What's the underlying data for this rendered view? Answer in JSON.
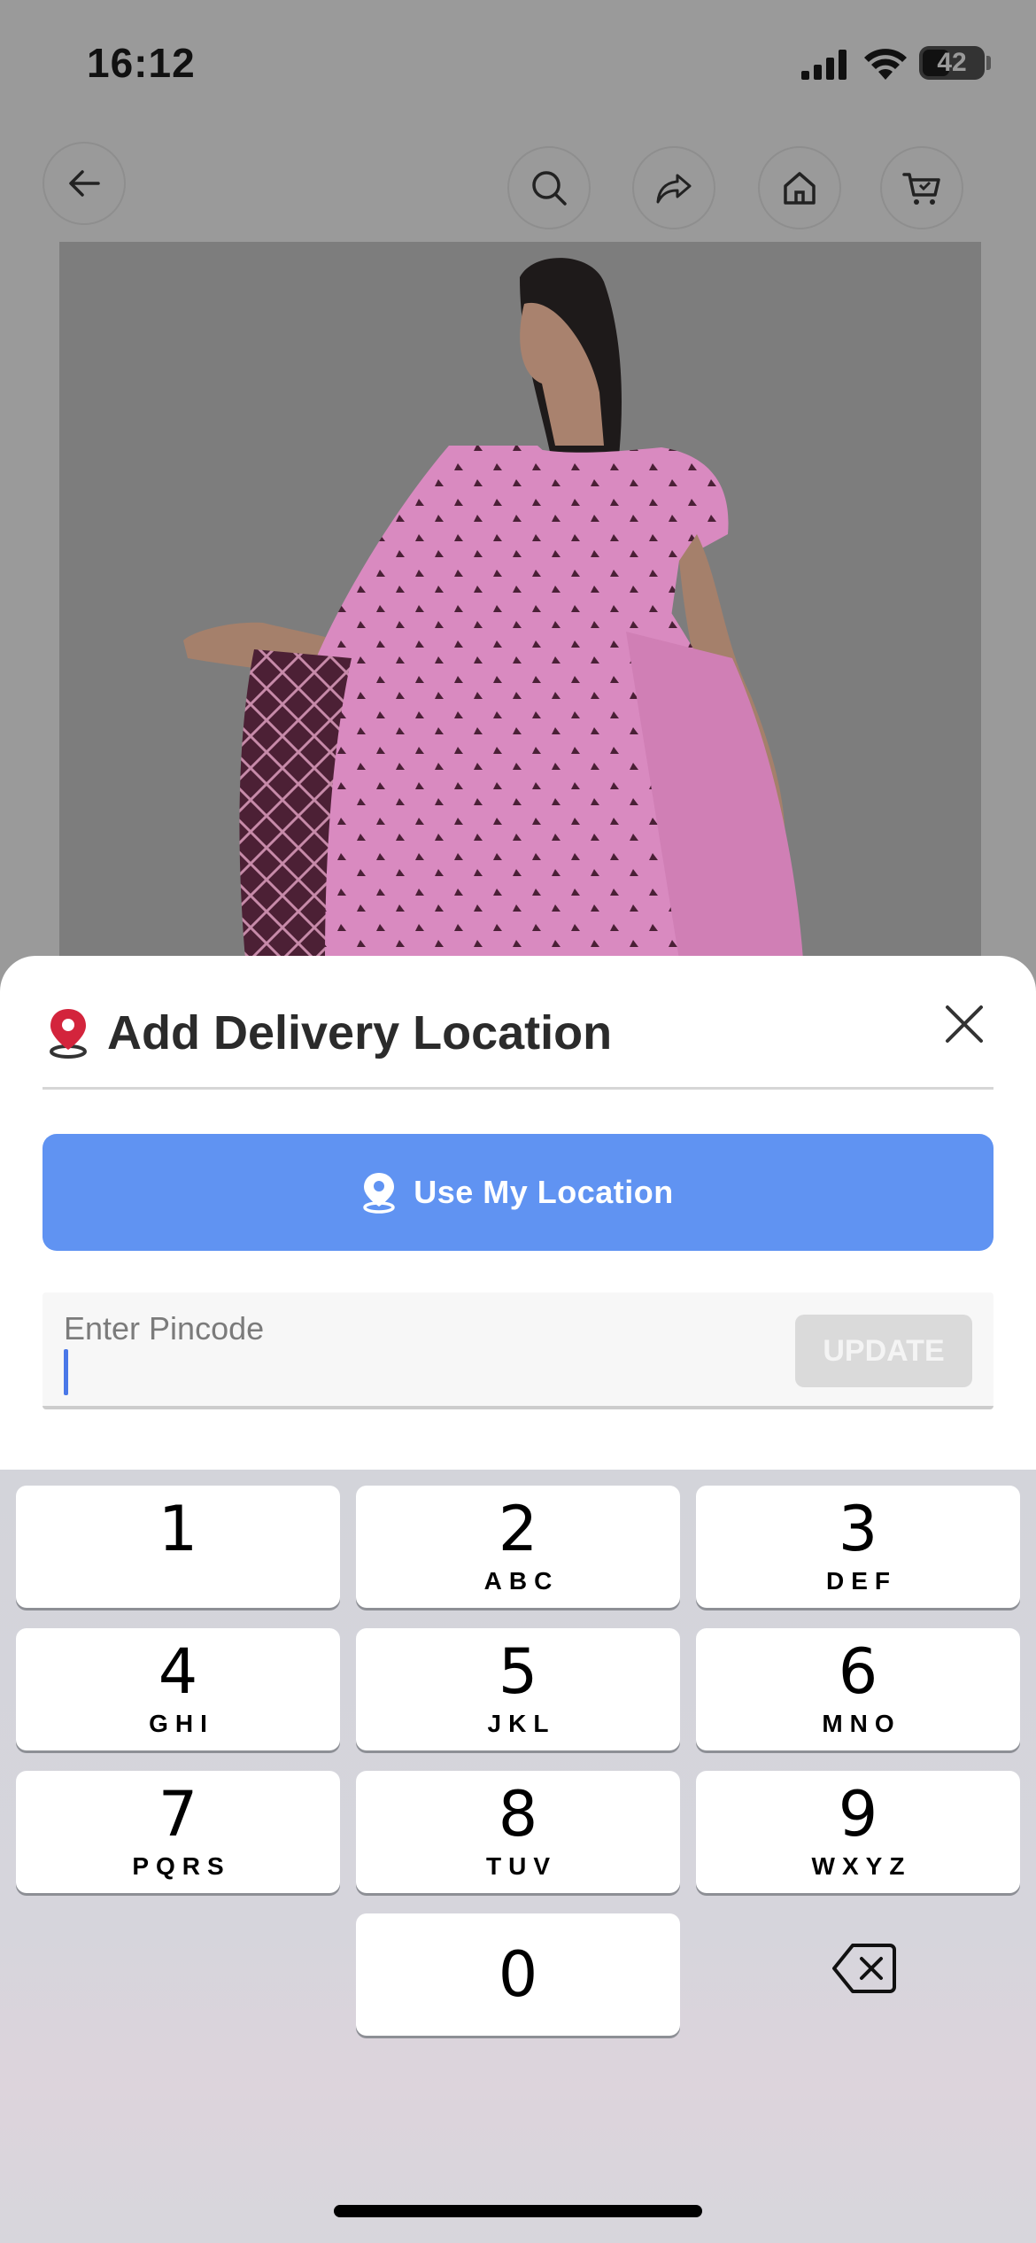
{
  "status_bar": {
    "time": "16:12",
    "battery": "42"
  },
  "nav": {
    "back_icon": "arrow-left-icon",
    "search_icon": "search-icon",
    "share_icon": "share-icon",
    "home_icon": "home-icon",
    "cart_icon": "cart-icon"
  },
  "colors": {
    "accent_blue": "#6093f2",
    "pin_red": "#d3243c",
    "overlay": "#9a9a9a",
    "saree_pink": "#d98ac0"
  },
  "sheet": {
    "title": "Add Delivery Location",
    "use_location_label": "Use My Location",
    "pincode_label": "Enter Pincode",
    "pincode_value": "",
    "update_label": "UPDATE"
  },
  "keypad": {
    "keys": [
      {
        "digit": "1",
        "letters": ""
      },
      {
        "digit": "2",
        "letters": "ABC"
      },
      {
        "digit": "3",
        "letters": "DEF"
      },
      {
        "digit": "4",
        "letters": "GHI"
      },
      {
        "digit": "5",
        "letters": "JKL"
      },
      {
        "digit": "6",
        "letters": "MNO"
      },
      {
        "digit": "7",
        "letters": "PQRS"
      },
      {
        "digit": "8",
        "letters": "TUV"
      },
      {
        "digit": "9",
        "letters": "WXYZ"
      },
      {
        "digit": "0",
        "letters": ""
      }
    ]
  }
}
